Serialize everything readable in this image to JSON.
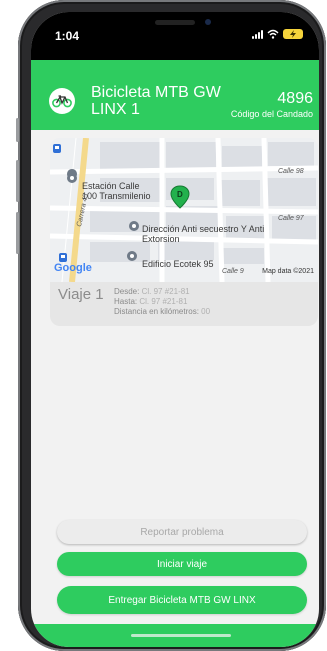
{
  "status_bar": {
    "time": "1:04"
  },
  "header": {
    "bike_name": "Bicicleta MTB GW LINX 1",
    "lock_code": "4896",
    "lock_code_label": "Código del Candado"
  },
  "map": {
    "places": [
      "Estación Calle 100 Transmilenio",
      "Dirección Anti secuestro Y Anti Extorsion",
      "Edificio Ecotek 95"
    ],
    "roads": [
      "Calle 98",
      "Carrera 45",
      "Calle 97",
      "Calle 9"
    ],
    "pin_label": "D",
    "google": "Google",
    "credit": "Map data ©2021"
  },
  "trip": {
    "title": "Viaje 1",
    "from_label": "Desde:",
    "from_value": "Cl. 97 #21-81",
    "to_label": "Hasta:",
    "to_value": "Cl. 97 #21-81",
    "distance_label": "Distancia en kilómetros:",
    "distance_value": "00"
  },
  "actions": {
    "report": "Reportar problema",
    "start": "Iniciar viaje",
    "return": "Entregar Bicicleta MTB GW LINX"
  },
  "colors": {
    "accent": "#2ecc5f",
    "battery": "#f5d33b"
  }
}
